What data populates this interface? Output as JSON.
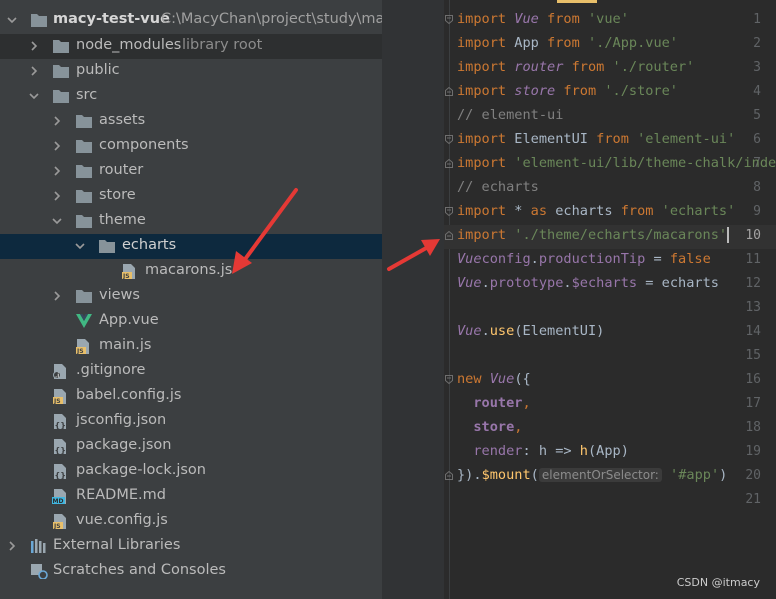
{
  "project": {
    "name": "macy-test-vue",
    "path": "C:\\MacyChan\\project\\study\\macy",
    "items": [
      {
        "label": "node_modules",
        "hint": "library root"
      },
      {
        "label": "public"
      },
      {
        "label": "src"
      },
      {
        "label": "assets"
      },
      {
        "label": "components"
      },
      {
        "label": "router"
      },
      {
        "label": "store"
      },
      {
        "label": "theme"
      },
      {
        "label": "echarts"
      },
      {
        "label": "macarons.js"
      },
      {
        "label": "views"
      },
      {
        "label": "App.vue"
      },
      {
        "label": "main.js"
      },
      {
        "label": ".gitignore"
      },
      {
        "label": "babel.config.js"
      },
      {
        "label": "jsconfig.json"
      },
      {
        "label": "package.json"
      },
      {
        "label": "package-lock.json"
      },
      {
        "label": "README.md"
      },
      {
        "label": "vue.config.js"
      },
      {
        "label": "External Libraries"
      },
      {
        "label": "Scratches and Consoles"
      }
    ]
  },
  "editor": {
    "line_numbers": [
      "1",
      "2",
      "3",
      "4",
      "5",
      "6",
      "7",
      "8",
      "9",
      "10",
      "11",
      "12",
      "13",
      "14",
      "15",
      "16",
      "17",
      "18",
      "19",
      "20",
      "21"
    ],
    "current_line": "10",
    "lines": {
      "l1": {
        "a": "import ",
        "b": "Vue",
        "c": " from ",
        "d": "'vue'"
      },
      "l2": {
        "a": "import ",
        "b": "App",
        "c": " from ",
        "d": "'./App.vue'"
      },
      "l3": {
        "a": "import ",
        "b": "router",
        "c": " from ",
        "d": "'./router'"
      },
      "l4": {
        "a": "import ",
        "b": "store",
        "c": " from ",
        "d": "'./store'"
      },
      "l5": {
        "a": "// element-ui"
      },
      "l6": {
        "a": "import ",
        "b": "ElementUI",
        "c": " from ",
        "d": "'element-ui'"
      },
      "l7": {
        "a": "import ",
        "b": "'element-ui/lib/theme-chalk/index"
      },
      "l8": {
        "a": "// echarts"
      },
      "l9": {
        "a": "import ",
        "b": "* ",
        "c": "as ",
        "d": "echarts ",
        "e": "from ",
        "f": "'echarts'"
      },
      "l10": {
        "a": "import ",
        "b": "'./theme/echarts/macarons'"
      },
      "l11": {
        "a": "Vue",
        ".": ".",
        "b": "config",
        "c": ".",
        "d": "productionTip",
        "e": " = ",
        "f": "false"
      },
      "l12": {
        "a": "Vue",
        "b": ".",
        "c": "prototype",
        "d": ".",
        "e": "$echarts",
        "f": " = echarts"
      },
      "l14": {
        "a": "Vue",
        "b": ".",
        "c": "use",
        "d": "(ElementUI)"
      },
      "l16": {
        "a": "new ",
        "b": "Vue",
        "c": "({"
      },
      "l17": {
        "a": "  ",
        "b": "router",
        ",": ","
      },
      "l18": {
        "a": "  ",
        "b": "store",
        ",": ","
      },
      "l19": {
        "a": "  ",
        "b": "render",
        "c": ": h => ",
        "d": "h",
        "e": "(App)"
      },
      "l20": {
        "a": "})",
        "b": ".",
        "c": "$mount",
        "d": "(",
        "hint": "elementOrSelector:",
        "e": "'#app'",
        "f": ")"
      }
    }
  },
  "watermark": "CSDN @itmacy",
  "colors": {
    "tree_bg": "#3c3f41",
    "editor_bg": "#2b2b2b",
    "selected_row": "#0d293e",
    "keyword": "#cc7832",
    "string": "#6a8759",
    "annotation_arrow": "#e53935"
  }
}
